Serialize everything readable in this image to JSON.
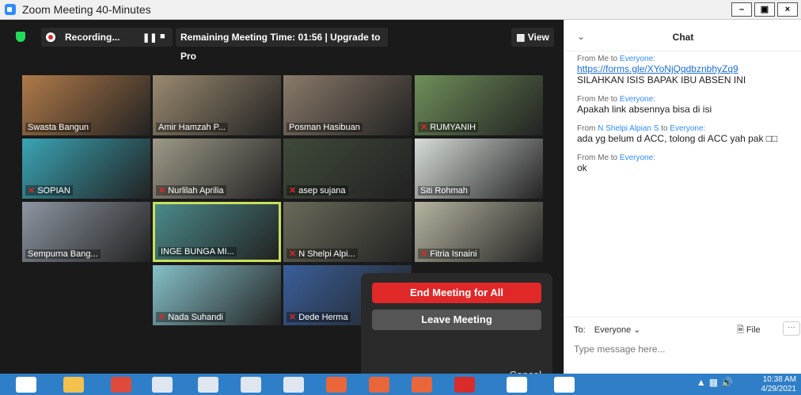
{
  "window": {
    "title": "Zoom Meeting 40-Minutes"
  },
  "meeting_bar": {
    "recording_label": "Recording...",
    "pause_icon": "pause-icon",
    "stop_icon": "stop-icon",
    "remaining_time_text": "Remaining Meeting Time: 01:56 | Upgrade to Pro",
    "view_label": "View"
  },
  "tiles": [
    {
      "name": "Swasta Bangun",
      "muted": false,
      "active": false,
      "color": "#b07a4a"
    },
    {
      "name": "Amir Hamzah P...",
      "muted": false,
      "active": false,
      "color": "#9a8a70"
    },
    {
      "name": "Posman Hasibuan",
      "muted": false,
      "active": false,
      "color": "#8a7a6a"
    },
    {
      "name": "RUMYANIH",
      "muted": true,
      "active": false,
      "color": "#6f8f5a"
    },
    {
      "name": "SOPIAN",
      "muted": true,
      "active": false,
      "color": "#3aa4b4"
    },
    {
      "name": "Nurlilah Aprilia",
      "muted": true,
      "active": false,
      "color": "#9e9a88"
    },
    {
      "name": "asep sujana",
      "muted": true,
      "active": false,
      "color": "#3f4a3a"
    },
    {
      "name": "Siti Rohmah",
      "muted": false,
      "active": false,
      "color": "#d6ddd8"
    },
    {
      "name": "Sempurna Bang...",
      "muted": false,
      "active": false,
      "color": "#8e96a2"
    },
    {
      "name": "INGE BUNGA MI...",
      "muted": false,
      "active": true,
      "color": "#4b8a8a"
    },
    {
      "name": "N Shelpi Alpi...",
      "muted": true,
      "active": false,
      "color": "#6a6a5a"
    },
    {
      "name": "Fitria Isnaini",
      "muted": true,
      "active": false,
      "color": "#b6b4a0"
    },
    {
      "name": "Nada Suhandi",
      "muted": true,
      "active": false,
      "color": "#86c0c8"
    },
    {
      "name": "Dede Herma",
      "muted": true,
      "active": false,
      "color": "#3a5f9a"
    }
  ],
  "end_popup": {
    "end_all_label": "End Meeting for All",
    "leave_label": "Leave Meeting",
    "cancel_label": "Cancel"
  },
  "chat": {
    "title": "Chat",
    "messages": [
      {
        "from_prefix": "From Me to",
        "to": "Everyone:",
        "link": "https://forms.gle/XYoNjQqdbznbhyZq9",
        "text": "SILAHKAN ISIS BAPAK IBU ABSEN INI"
      },
      {
        "from_prefix": "From Me to",
        "to": "Everyone:",
        "text": "Apakah link absennya bisa di isi"
      },
      {
        "from_prefix": "From",
        "sender": "N Shelpi Alpian S",
        "mid": "to",
        "to": "Everyone:",
        "text": "ada yg belum d ACC, tolong di ACC yah pak □□"
      },
      {
        "from_prefix": "From Me to",
        "to": "Everyone:",
        "text": "ok"
      }
    ],
    "to_label": "To:",
    "to_value": "Everyone",
    "file_label": "File",
    "more_label": "···",
    "placeholder": "Type message here..."
  },
  "taskbar": {
    "time": "10:38 AM",
    "date": "4/29/2021",
    "icons": [
      "start-icon",
      "file-explorer-icon",
      "chrome-icon",
      "word-icon",
      "word-icon",
      "word-icon",
      "word-icon",
      "powerpoint-icon",
      "powerpoint-icon",
      "powerpoint-icon",
      "pdf-icon",
      "zoom-icon",
      "zoom-icon"
    ]
  },
  "colors": {
    "accent": "#2d8cff",
    "end_red": "#e02828",
    "active_border": "#c8e05a",
    "taskbar": "#2f7fc8"
  }
}
